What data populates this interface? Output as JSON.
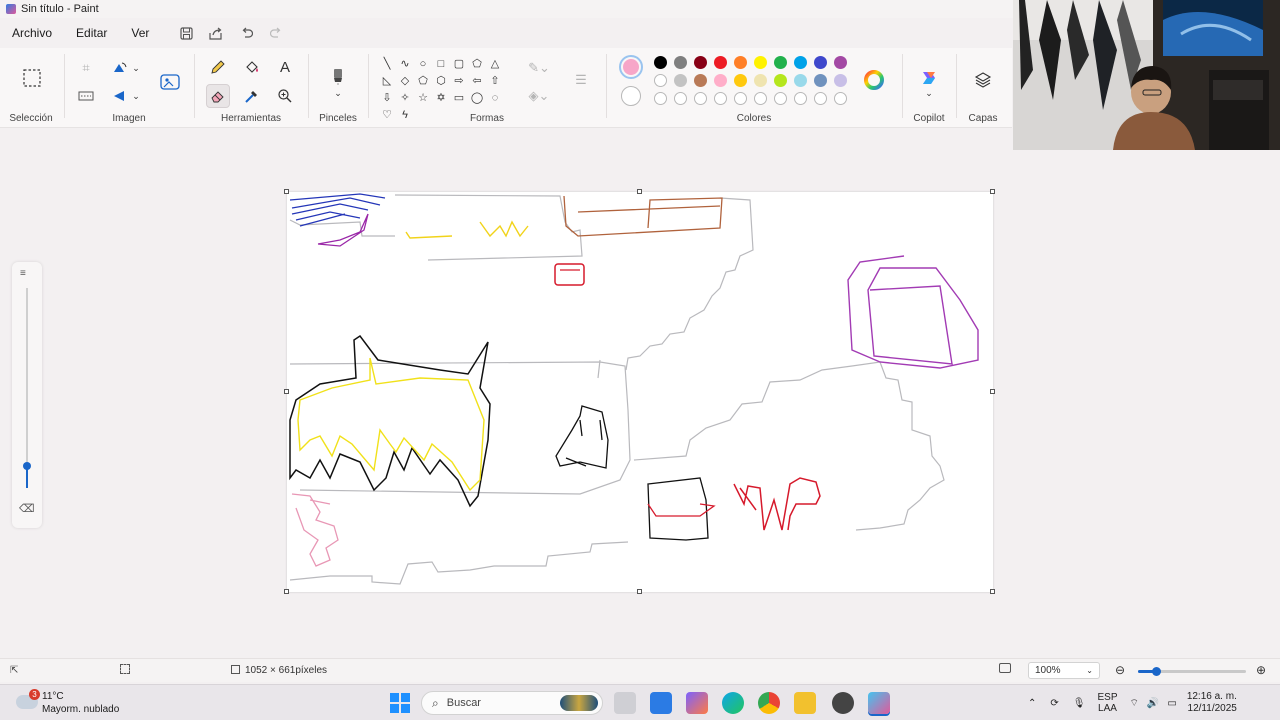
{
  "window": {
    "title": "Sin título - Paint"
  },
  "menu": {
    "file": "Archivo",
    "edit": "Editar",
    "view": "Ver"
  },
  "ribbon": {
    "selection": "Selección",
    "image": "Imagen",
    "tools": "Herramientas",
    "brushes": "Pinceles",
    "shapes": "Formas",
    "colors": "Colores",
    "copilot": "Copilot",
    "layers": "Capas"
  },
  "colors": {
    "primary": "#f7a6c8",
    "secondary": "#ffffff",
    "palette_row1": [
      "#000000",
      "#7f7f7f",
      "#880015",
      "#ed1c24",
      "#ff7f27",
      "#fff200",
      "#22b14c",
      "#00a2e8",
      "#3f48cc",
      "#a349a4"
    ],
    "palette_row2": [
      "#ffffff",
      "#c3c3c3",
      "#b97a57",
      "#ffaec9",
      "#ffc90e",
      "#efe4b0",
      "#b5e61d",
      "#99d9ea",
      "#7092be",
      "#c8bfe7"
    ]
  },
  "status": {
    "canvas_size": "1052 × 661píxeles",
    "zoom": "100%"
  },
  "taskbar": {
    "weather_temp": "11°C",
    "weather_desc": "Mayorm. nublado",
    "weather_badge": "3",
    "search_placeholder": "Buscar",
    "lang_1": "ESP",
    "lang_2": "LAA",
    "time": "12:16 a. m.",
    "date": "12/11/2025"
  }
}
